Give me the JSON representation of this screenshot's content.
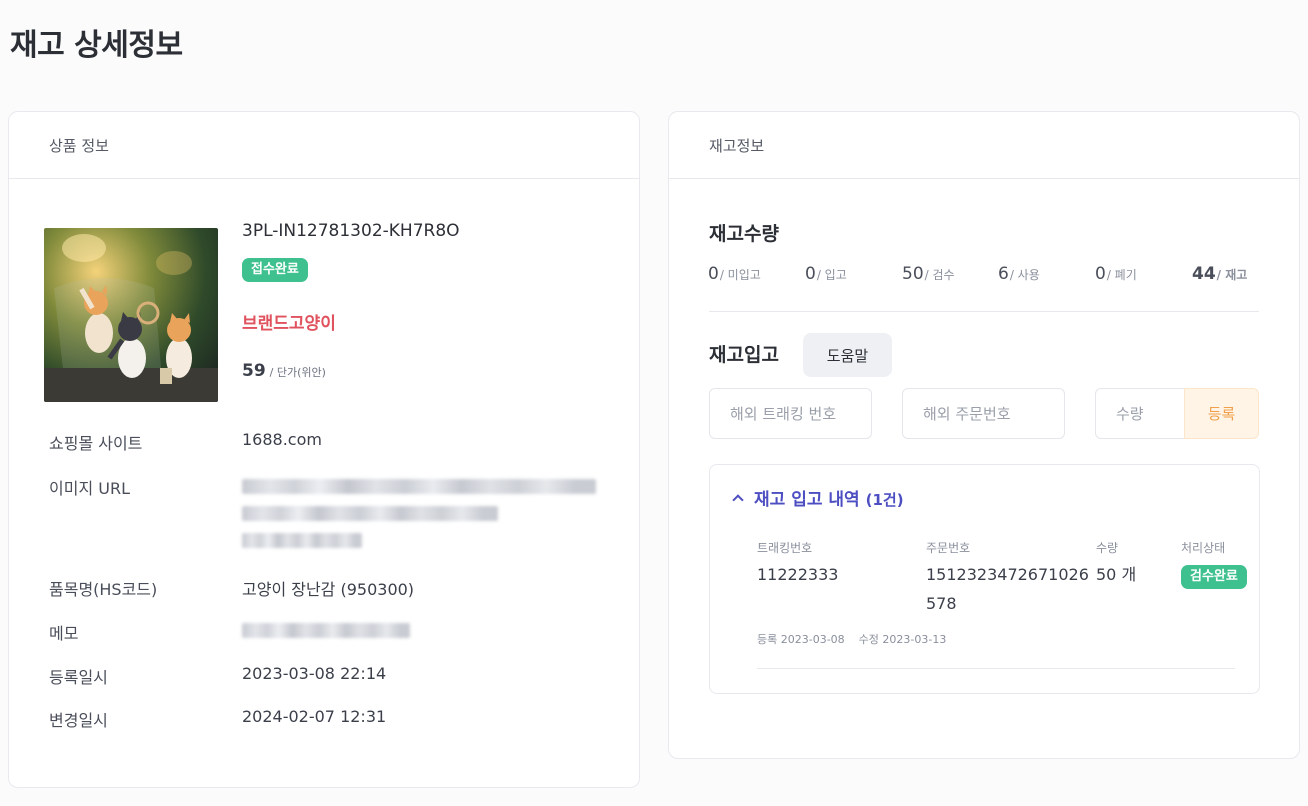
{
  "page": {
    "title": "재고 상세정보"
  },
  "product": {
    "header": "상품 정보",
    "sku": "3PL-IN12781302-KH7R8O",
    "status": "접수완료",
    "brand": "브랜드고양이",
    "price": "59",
    "price_unit": "/ 단가(위안)",
    "labels": {
      "site": "쇼핑몰 사이트",
      "image_url": "이미지 URL",
      "item_name": "품목명(HS코드)",
      "memo": "메모",
      "created": "등록일시",
      "updated": "변경일시"
    },
    "values": {
      "site": "1688.com",
      "item_name": "고양이 장난감 (950300)",
      "created": "2023-03-08 22:14",
      "updated": "2024-02-07 12:31"
    }
  },
  "stock": {
    "header": "재고정보",
    "qty_title": "재고수량",
    "stats": [
      {
        "value": "0",
        "label": "/ 미입고"
      },
      {
        "value": "0",
        "label": "/ 입고"
      },
      {
        "value": "50",
        "label": "/ 검수"
      },
      {
        "value": "6",
        "label": "/ 사용"
      },
      {
        "value": "0",
        "label": "/ 폐기"
      },
      {
        "value": "44",
        "label": "/ 재고"
      }
    ],
    "inbound_title": "재고입고",
    "help_label": "도움말",
    "tracking_placeholder": "해외 트래킹 번호",
    "order_placeholder": "해외 주문번호",
    "qty_placeholder": "수량",
    "register_label": "등록",
    "history": {
      "title": "재고 입고 내역",
      "count": "(1건)",
      "columns": {
        "tracking": "트래킹번호",
        "order": "주문번호",
        "qty": "수량",
        "status": "처리상태"
      },
      "row": {
        "tracking": "11222333",
        "order_line1": "1512323472671026",
        "order_line2": "578",
        "qty": "50 개",
        "status": "검수완료",
        "registered": "등록 2023-03-08",
        "modified": "수정 2023-03-13"
      }
    }
  }
}
